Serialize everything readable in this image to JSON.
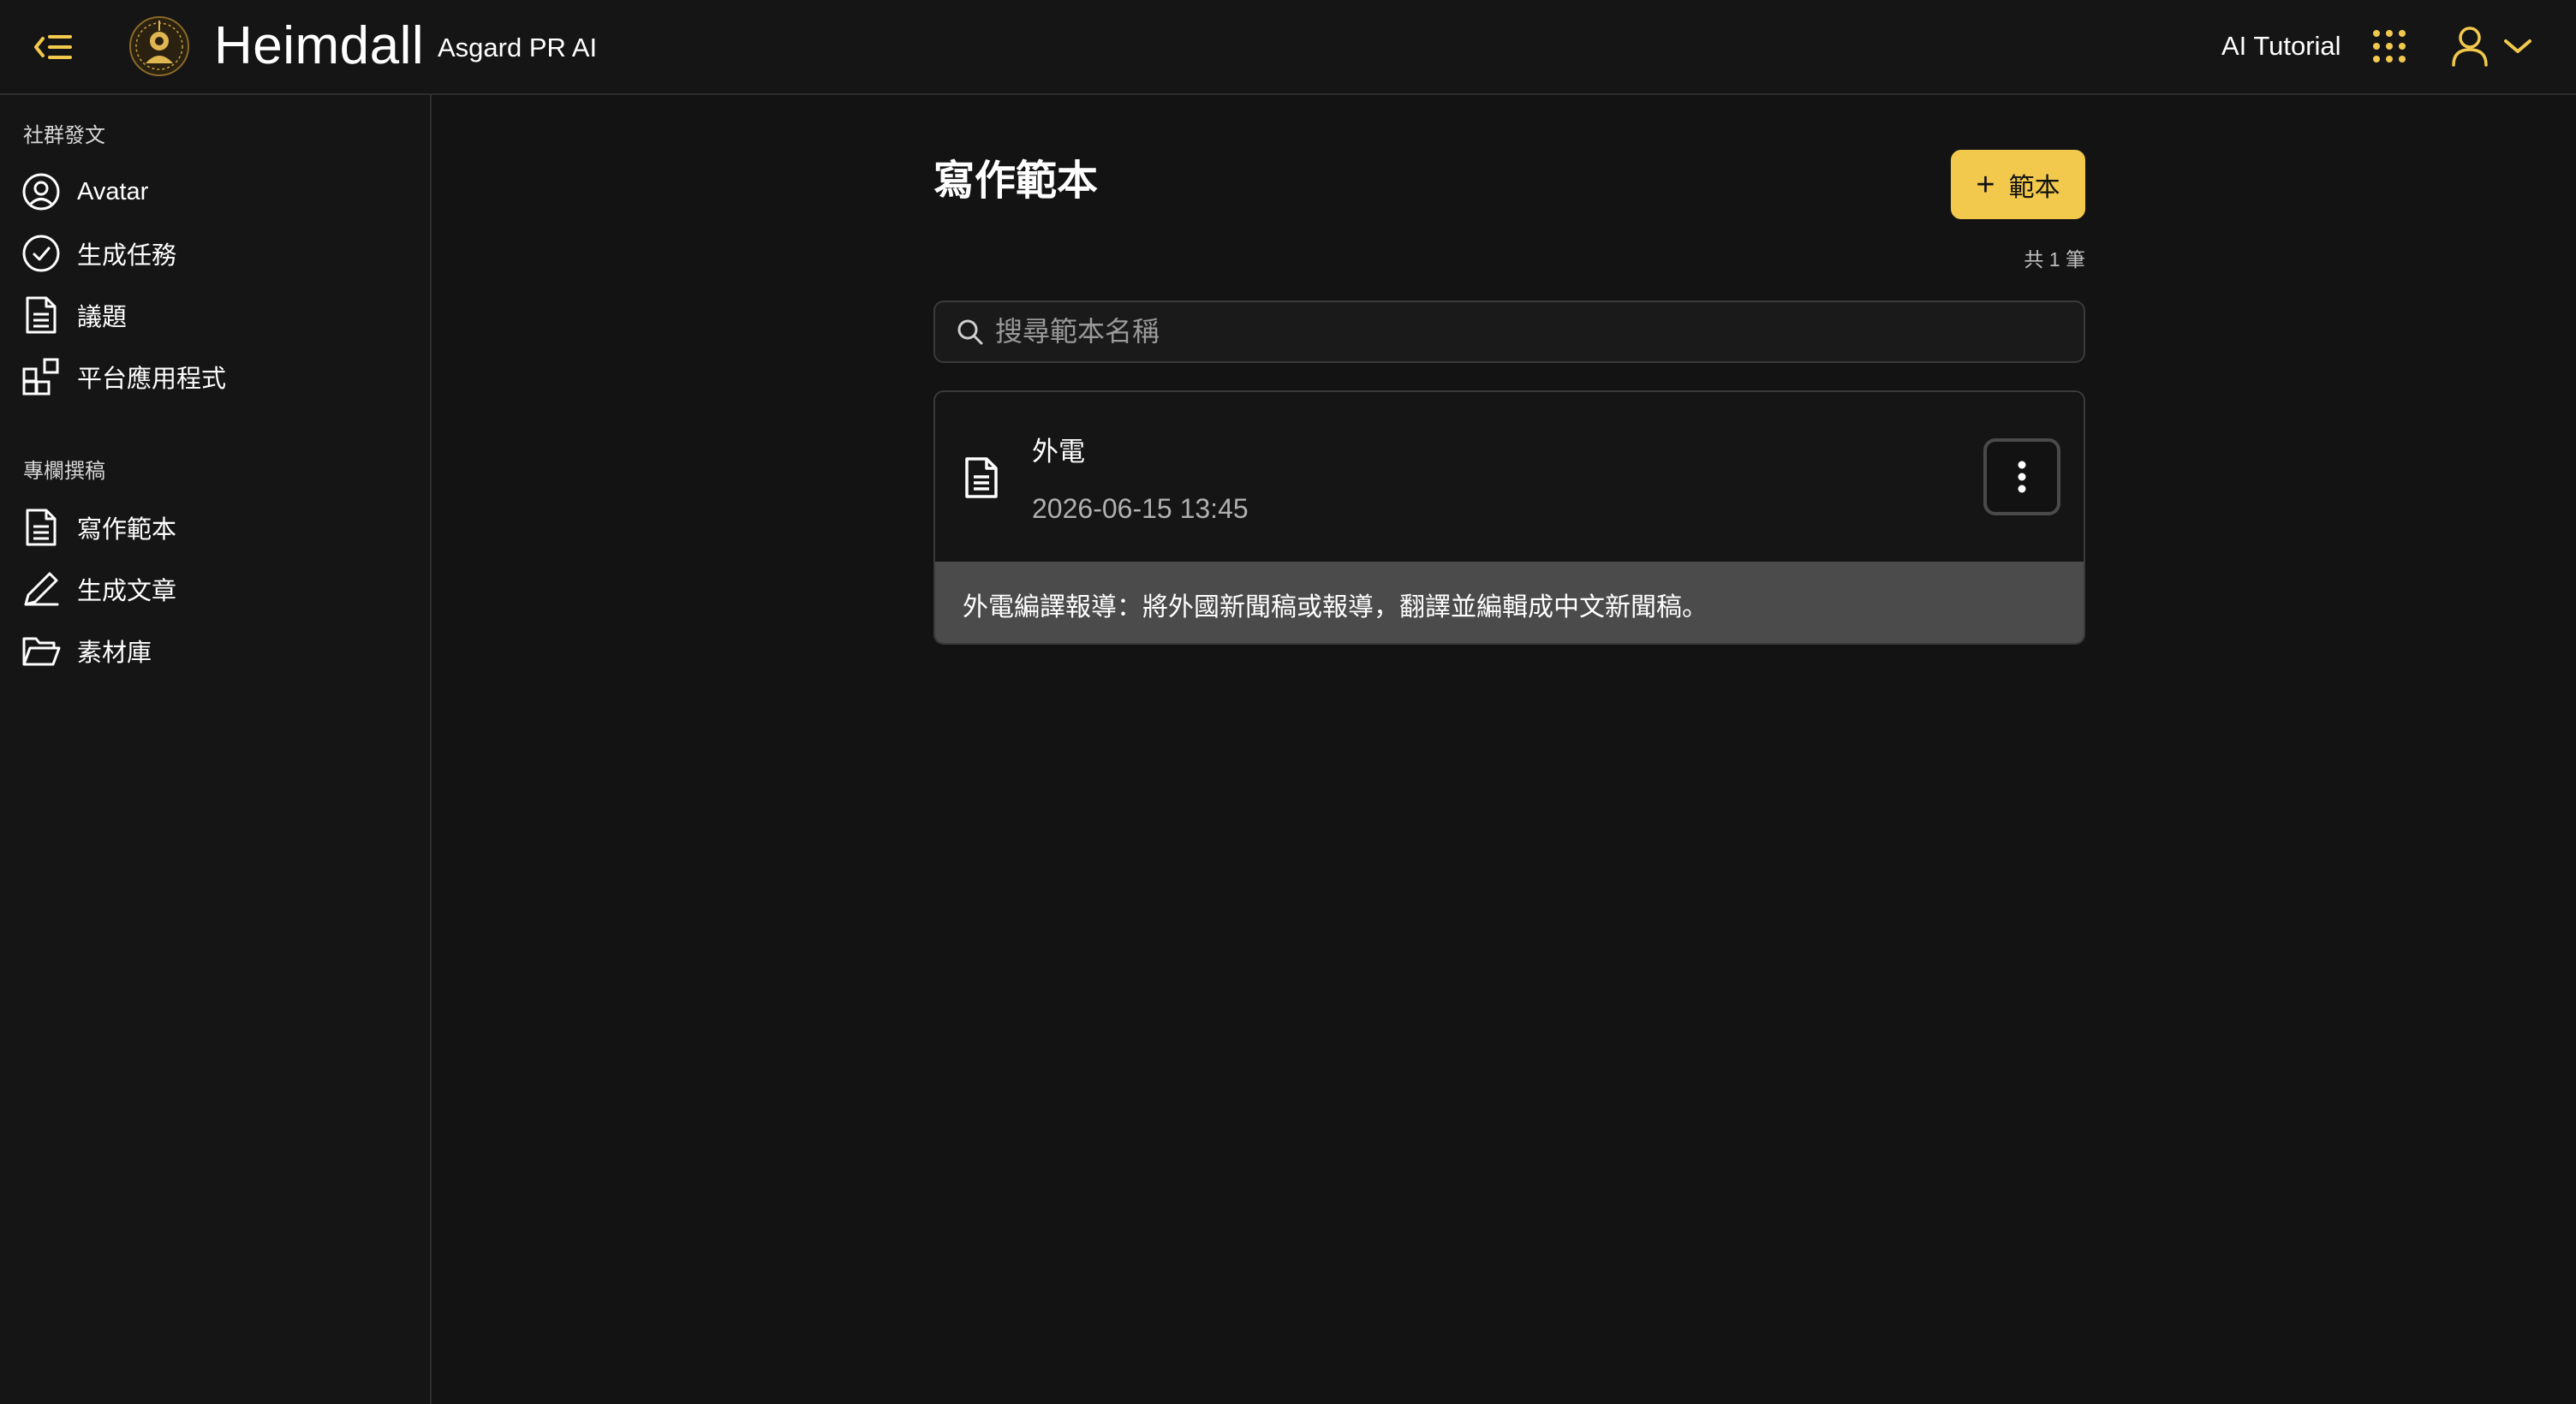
{
  "header": {
    "brand_name": "Heimdall",
    "brand_sub": "Asgard PR AI",
    "tutorial_label": "AI Tutorial",
    "accent": "#f2c94c"
  },
  "sidebar": {
    "sections": [
      {
        "title": "社群發文",
        "items": [
          {
            "label": "Avatar",
            "icon": "user-circle-icon"
          },
          {
            "label": "生成任務",
            "icon": "check-circle-icon"
          },
          {
            "label": "議題",
            "icon": "document-icon"
          },
          {
            "label": "平台應用程式",
            "icon": "apps-grid-icon"
          }
        ]
      },
      {
        "title": "專欄撰稿",
        "items": [
          {
            "label": "寫作範本",
            "icon": "document-icon"
          },
          {
            "label": "生成文章",
            "icon": "pencil-icon"
          },
          {
            "label": "素材庫",
            "icon": "folder-open-icon"
          }
        ]
      }
    ]
  },
  "main": {
    "title": "寫作範本",
    "add_button_label": "範本",
    "count_text": "共 1 筆",
    "search_placeholder": "搜尋範本名稱",
    "templates": [
      {
        "title": "外電",
        "date": "2026-06-15 13:45",
        "description": "外電編譯報導：將外國新聞稿或報導，翻譯並編輯成中文新聞稿。"
      }
    ]
  }
}
